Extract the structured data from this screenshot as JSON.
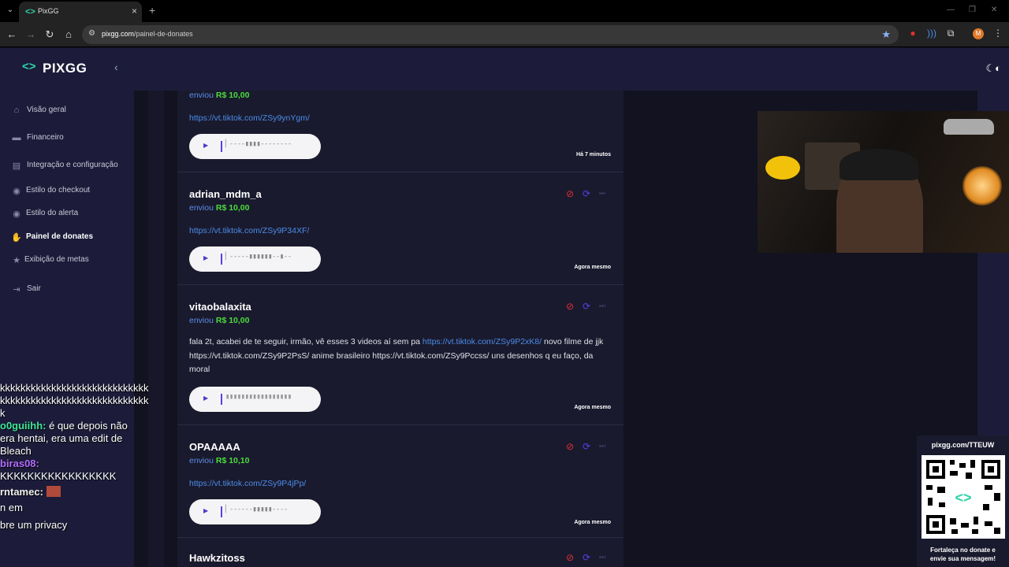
{
  "browser": {
    "tab_title": "PixGG",
    "url_host": "pixgg.com",
    "url_path": "/painel-de-donates",
    "profile_initial": "M"
  },
  "app": {
    "logo": "PIXGG",
    "nav": [
      {
        "label": "Visão geral",
        "icon": "home-icon"
      },
      {
        "label": "Financeiro",
        "icon": "wallet-icon"
      },
      {
        "label": "Integração e configuração",
        "icon": "integration-icon"
      },
      {
        "label": "Estilo do checkout",
        "icon": "palette-icon"
      },
      {
        "label": "Estilo do alerta",
        "icon": "palette-icon"
      },
      {
        "label": "Painel de donates",
        "icon": "donate-hand-icon"
      },
      {
        "label": "Exibição de metas",
        "icon": "star-icon"
      },
      {
        "label": "Sair",
        "icon": "logout-icon"
      }
    ],
    "active_nav": "Painel de donates"
  },
  "donates": [
    {
      "name": "",
      "sent_label": "enviou",
      "amount": "R$ 10,00",
      "link": "https://vt.tiktok.com/ZSy9ynYgm/",
      "time": "Há 7 minutos",
      "wave": "▏----▮▮▮▮--------"
    },
    {
      "name": "adrian_mdm_a",
      "sent_label": "enviou",
      "amount": "R$ 10,00",
      "link": "https://vt.tiktok.com/ZSy9P34XF/",
      "time": "Agora mesmo",
      "wave": "▏-----▮▮▮▮▮▮--▮--"
    },
    {
      "name": "vitaobalaxita",
      "sent_label": "enviou",
      "amount": "R$ 10,00",
      "msg_pre": "fala 2t, acabei de te seguir, irmão, vê esses 3 videos aí sem pa ",
      "msg_link": "https://vt.tiktok.com/ZSy9P2xK8/",
      "msg_post": " novo filme de jjk https://vt.tiktok.com/ZSy9P2PsS/ anime brasileiro https://vt.tiktok.com/ZSy9Pccss/ uns desenhos q eu faço, da moral",
      "time": "Agora mesmo",
      "wave": "▮▮▮▮▮▮▮▮▮▮▮▮▮▮▮▮▮"
    },
    {
      "name": "OPAAAAA",
      "sent_label": "enviou",
      "amount": "R$ 10,10",
      "link": "https://vt.tiktok.com/ZSy9P4jPp/",
      "time": "Agora mesmo",
      "wave": "▏------▮▮▮▮▮----"
    },
    {
      "name": "Hawkzitoss"
    }
  ],
  "chat": [
    {
      "text": "kkkkkkkkkkkkkkkkkkkkkkkkkkkkk"
    },
    {
      "text": "kkkkkkkkkkkkkkkkkkkkkkkkkkkkk"
    },
    {
      "text": "k"
    },
    {
      "user": "o0guiihh:",
      "text": " é que depois não"
    },
    {
      "text": "era hentai, era uma edit de"
    },
    {
      "text": "Bleach"
    },
    {
      "user": "biras08:",
      "text": ""
    },
    {
      "text": "KKKKKKKKKKKKKKKKK"
    },
    {
      "user": "rntamec:",
      "text": ""
    },
    {
      "text": "n em"
    },
    {
      "text": "bre um privacy"
    }
  ],
  "qr": {
    "title": "pixgg.com/TTEUW",
    "caption_line1": "Fortaleça no donate e",
    "caption_line2": "envie sua mensagem!"
  }
}
